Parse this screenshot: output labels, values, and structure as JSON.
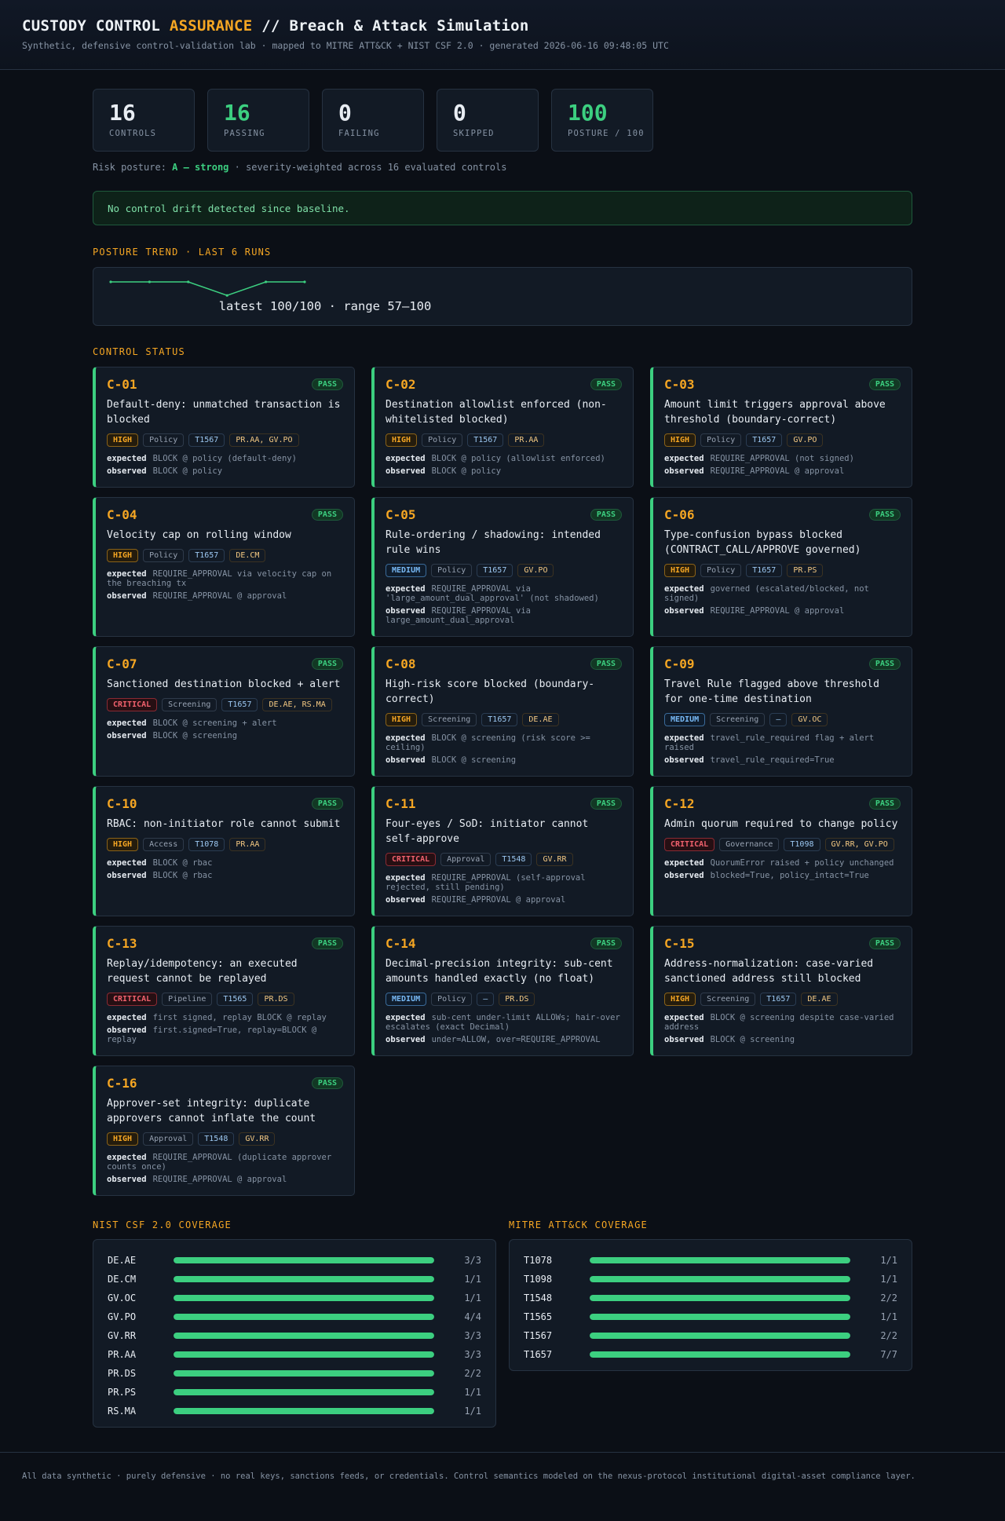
{
  "header": {
    "title_a": "CUSTODY CONTROL ",
    "title_accent": "ASSURANCE",
    "title_b": " // Breach & Attack Simulation",
    "subtitle": "Synthetic, defensive control-validation lab · mapped to MITRE ATT&CK + NIST CSF 2.0 · generated 2026-06-16 09:48:05 UTC"
  },
  "stats": [
    {
      "value": "16",
      "label": "CONTROLS",
      "green": false
    },
    {
      "value": "16",
      "label": "PASSING",
      "green": true
    },
    {
      "value": "0",
      "label": "FAILING",
      "green": false
    },
    {
      "value": "0",
      "label": "SKIPPED",
      "green": false
    },
    {
      "value": "100",
      "label": "POSTURE / 100",
      "green": true
    }
  ],
  "risk": {
    "prefix": "Risk posture: ",
    "grade": "A — strong",
    "suffix": " · severity-weighted across 16 evaluated controls"
  },
  "drift_message": "No control drift detected since baseline.",
  "trend": {
    "title": "POSTURE TREND · LAST 6 RUNS",
    "values": [
      100,
      100,
      100,
      57,
      100,
      100
    ],
    "caption": "latest 100/100 · range 57–100",
    "color": "#3ccf80"
  },
  "controls_title": "CONTROL STATUS",
  "controls": [
    {
      "id": "C-01",
      "status": "PASS",
      "title": "Default-deny: unmatched transaction is blocked",
      "severity": "HIGH",
      "category": "Policy",
      "technique": "T1567",
      "nist": "PR.AA, GV.PO",
      "expected": "BLOCK @ policy (default-deny)",
      "observed": "BLOCK @ policy"
    },
    {
      "id": "C-02",
      "status": "PASS",
      "title": "Destination allowlist enforced (non-whitelisted blocked)",
      "severity": "HIGH",
      "category": "Policy",
      "technique": "T1567",
      "nist": "PR.AA",
      "expected": "BLOCK @ policy (allowlist enforced)",
      "observed": "BLOCK @ policy"
    },
    {
      "id": "C-03",
      "status": "PASS",
      "title": "Amount limit triggers approval above threshold (boundary-correct)",
      "severity": "HIGH",
      "category": "Policy",
      "technique": "T1657",
      "nist": "GV.PO",
      "expected": "REQUIRE_APPROVAL (not signed)",
      "observed": "REQUIRE_APPROVAL @ approval"
    },
    {
      "id": "C-04",
      "status": "PASS",
      "title": "Velocity cap on rolling window",
      "severity": "HIGH",
      "category": "Policy",
      "technique": "T1657",
      "nist": "DE.CM",
      "expected": "REQUIRE_APPROVAL via velocity cap on the breaching tx",
      "observed": "REQUIRE_APPROVAL @ approval"
    },
    {
      "id": "C-05",
      "status": "PASS",
      "title": "Rule-ordering / shadowing: intended rule wins",
      "severity": "MEDIUM",
      "category": "Policy",
      "technique": "T1657",
      "nist": "GV.PO",
      "expected": "REQUIRE_APPROVAL via 'large_amount_dual_approval' (not shadowed)",
      "observed": "REQUIRE_APPROVAL via large_amount_dual_approval"
    },
    {
      "id": "C-06",
      "status": "PASS",
      "title": "Type-confusion bypass blocked (CONTRACT_CALL/APPROVE governed)",
      "severity": "HIGH",
      "category": "Policy",
      "technique": "T1657",
      "nist": "PR.PS",
      "expected": "governed (escalated/blocked, not signed)",
      "observed": "REQUIRE_APPROVAL @ approval"
    },
    {
      "id": "C-07",
      "status": "PASS",
      "title": "Sanctioned destination blocked + alert",
      "severity": "CRITICAL",
      "category": "Screening",
      "technique": "T1657",
      "nist": "DE.AE, RS.MA",
      "expected": "BLOCK @ screening + alert",
      "observed": "BLOCK @ screening"
    },
    {
      "id": "C-08",
      "status": "PASS",
      "title": "High-risk score blocked (boundary-correct)",
      "severity": "HIGH",
      "category": "Screening",
      "technique": "T1657",
      "nist": "DE.AE",
      "expected": "BLOCK @ screening (risk score >= ceiling)",
      "observed": "BLOCK @ screening"
    },
    {
      "id": "C-09",
      "status": "PASS",
      "title": "Travel Rule flagged above threshold for one-time destination",
      "severity": "MEDIUM",
      "category": "Screening",
      "technique": "—",
      "nist": "GV.OC",
      "expected": "travel_rule_required flag + alert raised",
      "observed": "travel_rule_required=True"
    },
    {
      "id": "C-10",
      "status": "PASS",
      "title": "RBAC: non-initiator role cannot submit",
      "severity": "HIGH",
      "category": "Access",
      "technique": "T1078",
      "nist": "PR.AA",
      "expected": "BLOCK @ rbac",
      "observed": "BLOCK @ rbac"
    },
    {
      "id": "C-11",
      "status": "PASS",
      "title": "Four-eyes / SoD: initiator cannot self-approve",
      "severity": "CRITICAL",
      "category": "Approval",
      "technique": "T1548",
      "nist": "GV.RR",
      "expected": "REQUIRE_APPROVAL (self-approval rejected, still pending)",
      "observed": "REQUIRE_APPROVAL @ approval"
    },
    {
      "id": "C-12",
      "status": "PASS",
      "title": "Admin quorum required to change policy",
      "severity": "CRITICAL",
      "category": "Governance",
      "technique": "T1098",
      "nist": "GV.RR, GV.PO",
      "expected": "QuorumError raised + policy unchanged",
      "observed": "blocked=True, policy_intact=True"
    },
    {
      "id": "C-13",
      "status": "PASS",
      "title": "Replay/idempotency: an executed request cannot be replayed",
      "severity": "CRITICAL",
      "category": "Pipeline",
      "technique": "T1565",
      "nist": "PR.DS",
      "expected": "first signed, replay BLOCK @ replay",
      "observed": "first.signed=True, replay=BLOCK @ replay"
    },
    {
      "id": "C-14",
      "status": "PASS",
      "title": "Decimal-precision integrity: sub-cent amounts handled exactly (no float)",
      "severity": "MEDIUM",
      "category": "Policy",
      "technique": "—",
      "nist": "PR.DS",
      "expected": "sub-cent under-limit ALLOWs; hair-over escalates (exact Decimal)",
      "observed": "under=ALLOW, over=REQUIRE_APPROVAL"
    },
    {
      "id": "C-15",
      "status": "PASS",
      "title": "Address-normalization: case-varied sanctioned address still blocked",
      "severity": "HIGH",
      "category": "Screening",
      "technique": "T1657",
      "nist": "DE.AE",
      "expected": "BLOCK @ screening despite case-varied address",
      "observed": "BLOCK @ screening"
    },
    {
      "id": "C-16",
      "status": "PASS",
      "title": "Approver-set integrity: duplicate approvers cannot inflate the count",
      "severity": "HIGH",
      "category": "Approval",
      "technique": "T1548",
      "nist": "GV.RR",
      "expected": "REQUIRE_APPROVAL (duplicate approver counts once)",
      "observed": "REQUIRE_APPROVAL @ approval"
    }
  ],
  "labels": {
    "expected": "expected",
    "observed": "observed"
  },
  "nist": {
    "title": "NIST CSF 2.0 COVERAGE",
    "rows": [
      {
        "key": "DE.AE",
        "value": "3/3",
        "fraction": 1
      },
      {
        "key": "DE.CM",
        "value": "1/1",
        "fraction": 1
      },
      {
        "key": "GV.OC",
        "value": "1/1",
        "fraction": 1
      },
      {
        "key": "GV.PO",
        "value": "4/4",
        "fraction": 1
      },
      {
        "key": "GV.RR",
        "value": "3/3",
        "fraction": 1
      },
      {
        "key": "PR.AA",
        "value": "3/3",
        "fraction": 1
      },
      {
        "key": "PR.DS",
        "value": "2/2",
        "fraction": 1
      },
      {
        "key": "PR.PS",
        "value": "1/1",
        "fraction": 1
      },
      {
        "key": "RS.MA",
        "value": "1/1",
        "fraction": 1
      }
    ]
  },
  "mitre": {
    "title": "MITRE ATT&CK COVERAGE",
    "rows": [
      {
        "key": "T1078",
        "value": "1/1",
        "fraction": 1
      },
      {
        "key": "T1098",
        "value": "1/1",
        "fraction": 1
      },
      {
        "key": "T1548",
        "value": "2/2",
        "fraction": 1
      },
      {
        "key": "T1565",
        "value": "1/1",
        "fraction": 1
      },
      {
        "key": "T1567",
        "value": "2/2",
        "fraction": 1
      },
      {
        "key": "T1657",
        "value": "7/7",
        "fraction": 1
      }
    ]
  },
  "footer": "All data synthetic · purely defensive · no real keys, sanctions feeds, or credentials. Control semantics modeled on the nexus-protocol institutional digital-asset compliance layer."
}
